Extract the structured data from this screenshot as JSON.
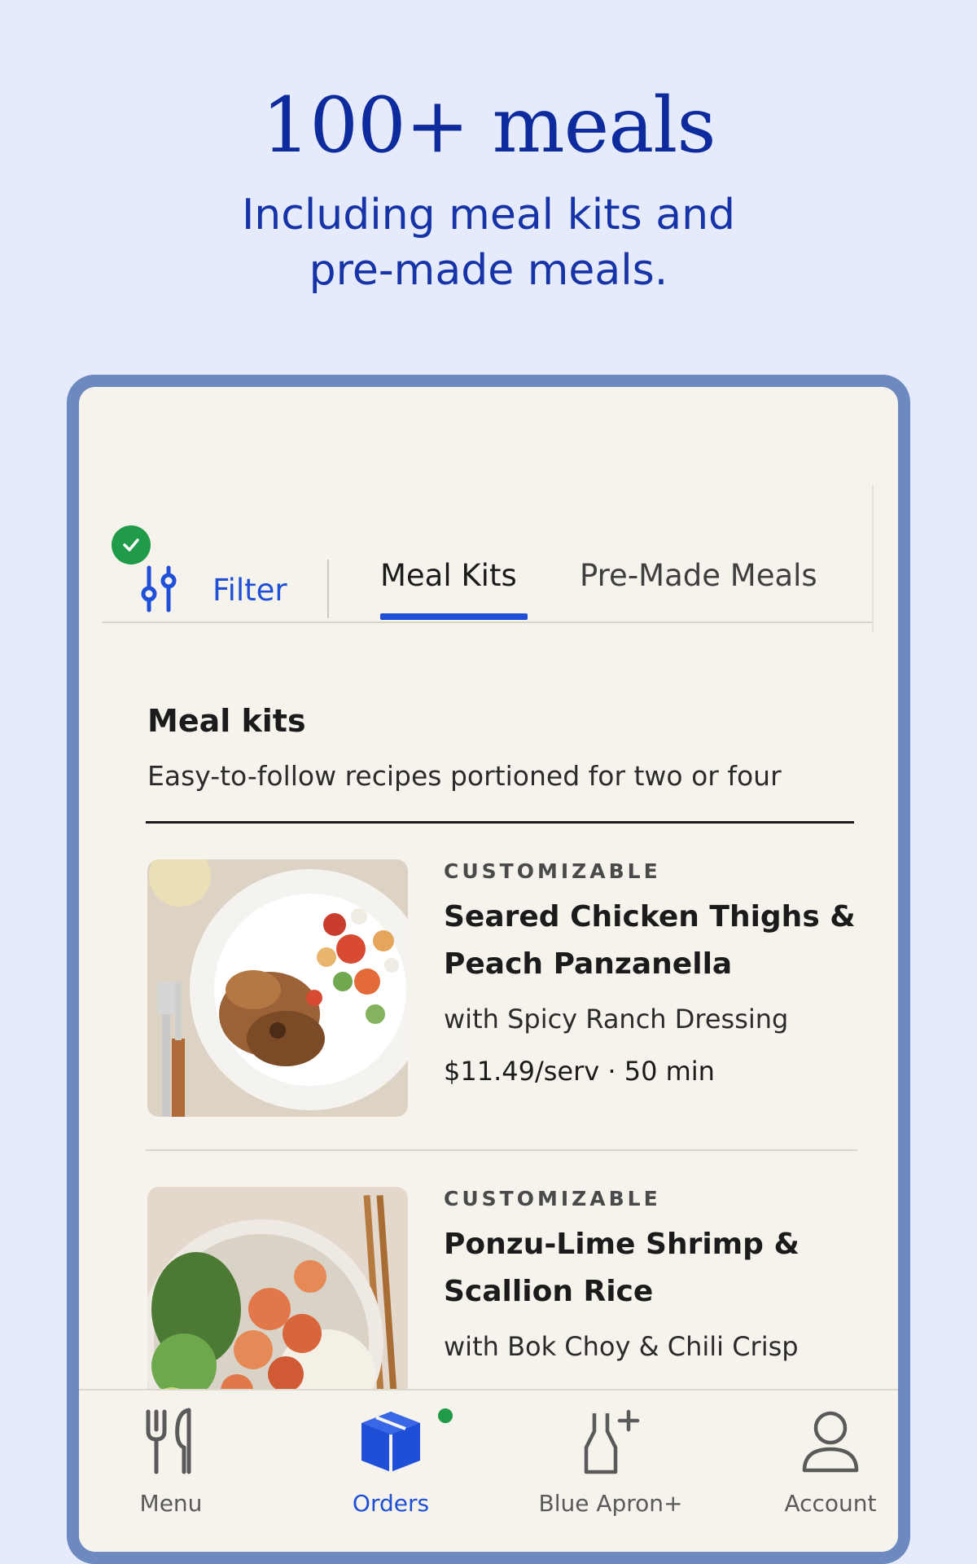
{
  "hero": {
    "title": "100+ meals",
    "subtitle_line1": "Including meal kits and",
    "subtitle_line2": "pre-made meals."
  },
  "tabs": {
    "filter_label": "Filter",
    "filter_applied": true,
    "items": [
      {
        "label": "Meal Kits",
        "active": true
      },
      {
        "label": "Pre-Made Meals",
        "active": false
      }
    ]
  },
  "section": {
    "title": "Meal kits",
    "description": "Easy-to-follow recipes portioned for two or four"
  },
  "meals": [
    {
      "tag": "CUSTOMIZABLE",
      "name_line1": "Seared Chicken Thighs &",
      "name_line2": "Peach Panzanella",
      "subtitle": "with Spicy Ranch Dressing",
      "meta": "$11.49/serv · 50 min"
    },
    {
      "tag": "CUSTOMIZABLE",
      "name_line1": "Ponzu-Lime Shrimp &",
      "name_line2": "Scallion Rice",
      "subtitle": "with Bok Choy & Chili Crisp"
    }
  ],
  "bottom_nav": {
    "items": [
      {
        "label": "Menu",
        "icon": "fork-knife-icon",
        "active": false
      },
      {
        "label": "Orders",
        "icon": "box-icon",
        "active": true
      },
      {
        "label": "Blue Apron+",
        "icon": "apron-plus-icon",
        "active": false
      },
      {
        "label": "Account",
        "icon": "person-icon",
        "active": false
      }
    ]
  },
  "colors": {
    "background": "#e5ebfb",
    "device_frame": "#6d8ac0",
    "screen": "#f6f3ec",
    "accent_blue": "#1f4fd6",
    "hero_blue": "#0e2b9e",
    "status_green": "#1f9b4a"
  }
}
